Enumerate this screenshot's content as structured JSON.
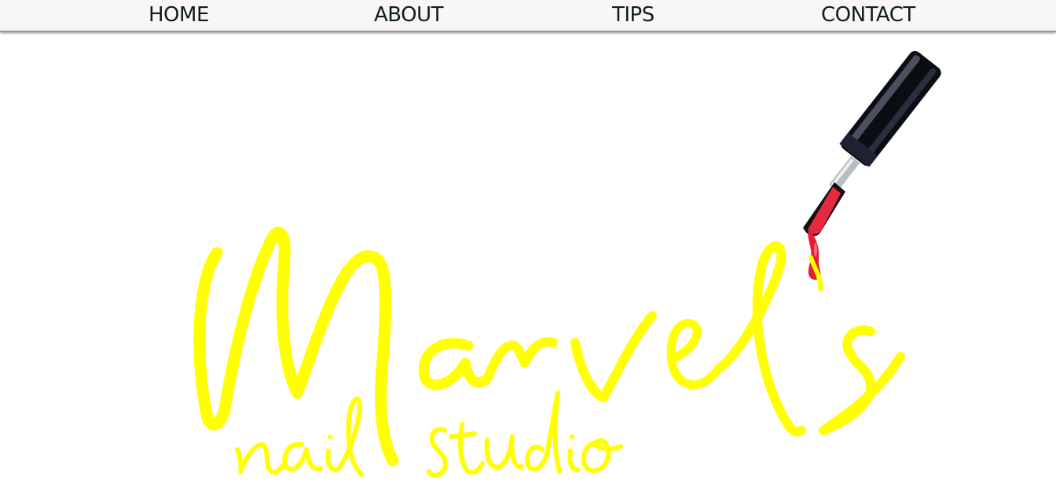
{
  "nav": {
    "items": [
      {
        "label": "HOME"
      },
      {
        "label": "ABOUT"
      },
      {
        "label": "TIPS"
      },
      {
        "label": "CONTACT"
      }
    ]
  },
  "logo": {
    "brand": "Marvel's",
    "tagline": "nail studio",
    "color": "#ffff00"
  },
  "colors": {
    "nav_background": "#f8f7f5",
    "nav_text": "#0f1d18",
    "polish": "#e8283f",
    "cap": "#0b0d12"
  }
}
